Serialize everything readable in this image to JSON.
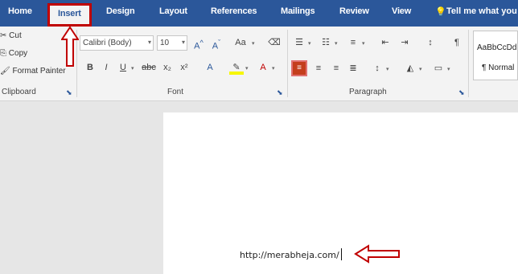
{
  "tabs": [
    {
      "label": "Home"
    },
    {
      "label": "Insert"
    },
    {
      "label": "Design"
    },
    {
      "label": "Layout"
    },
    {
      "label": "References"
    },
    {
      "label": "Mailings"
    },
    {
      "label": "Review"
    },
    {
      "label": "View"
    }
  ],
  "tell_me": "Tell me what you want",
  "clipboard": {
    "cut": "Cut",
    "copy": "Copy",
    "format_painter": "Format Painter",
    "label": "Clipboard"
  },
  "font": {
    "name": "Calibri (Body)",
    "size": "10",
    "label": "Font"
  },
  "paragraph": {
    "label": "Paragraph"
  },
  "styles": {
    "preview": "AaBbCcDd",
    "normal": "¶ Normal"
  },
  "document": {
    "text": "http://merabheja.com/"
  },
  "colors": {
    "accent": "#2b579a",
    "annotation": "#c00000"
  }
}
